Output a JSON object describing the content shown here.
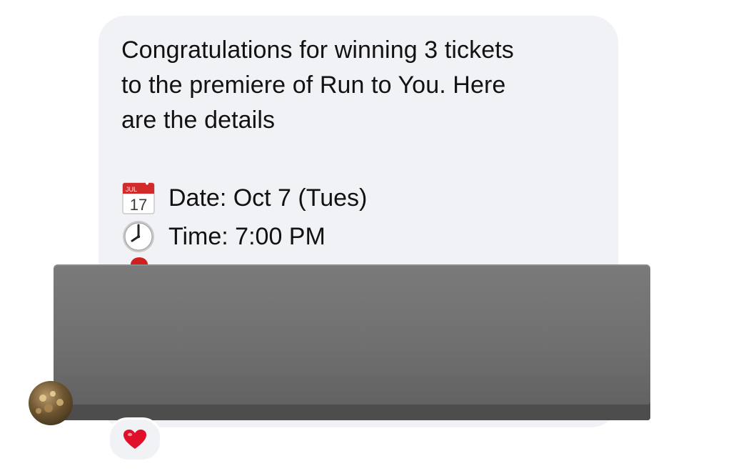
{
  "message": {
    "lines": [
      "Congratulations for winning 3 tickets",
      "to the premiere of Run to You. Here",
      "are the details"
    ],
    "details": [
      {
        "icon": "calendar-icon",
        "calendar_month": "JUL",
        "calendar_day": "17",
        "text": "Date: Oct 7 (Tues)"
      },
      {
        "icon": "clock-icon",
        "text": "Time: 7:00 PM"
      }
    ]
  },
  "reaction": {
    "icon": "heart-icon",
    "color": "#e0102a"
  },
  "colors": {
    "bubble": "#f1f2f5",
    "text": "#121212",
    "redaction": "#6f6f6f"
  }
}
